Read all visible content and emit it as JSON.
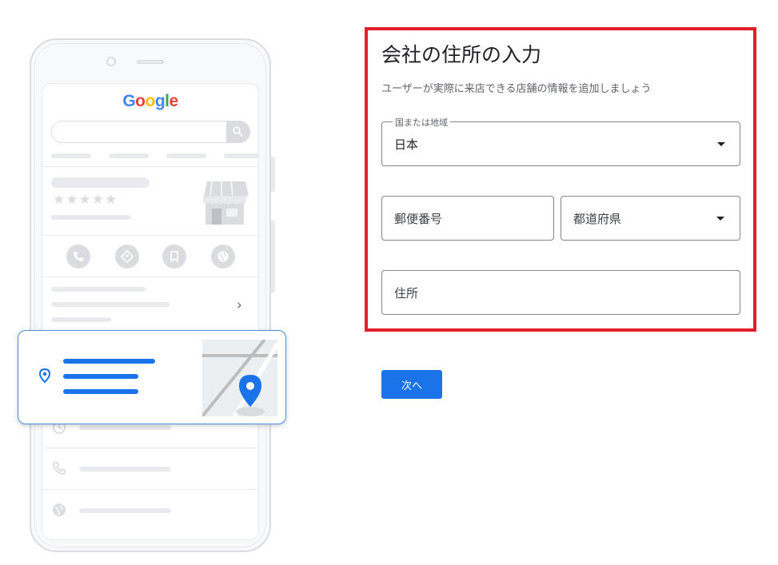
{
  "illustration": {
    "logo": {
      "letters": [
        {
          "char": "G",
          "color": "#4285f4"
        },
        {
          "char": "o",
          "color": "#ea4335"
        },
        {
          "char": "o",
          "color": "#fbbc05"
        },
        {
          "char": "g",
          "color": "#4285f4"
        },
        {
          "char": "l",
          "color": "#34a853"
        },
        {
          "char": "e",
          "color": "#ea4335"
        }
      ]
    },
    "rating_stars": "★★★★★",
    "chevron": "›"
  },
  "form": {
    "title": "会社の住所の入力",
    "subtitle": "ユーザーが実際に来店できる店舗の情報を追加しましょう",
    "country": {
      "label": "国または地域",
      "value": "日本"
    },
    "postal_code": {
      "placeholder": "郵便番号"
    },
    "prefecture": {
      "placeholder": "都道府県"
    },
    "address": {
      "placeholder": "住所"
    },
    "highlight_color": "#e01e2c"
  },
  "actions": {
    "next_label": "次へ",
    "accent_color": "#1a73e8"
  }
}
